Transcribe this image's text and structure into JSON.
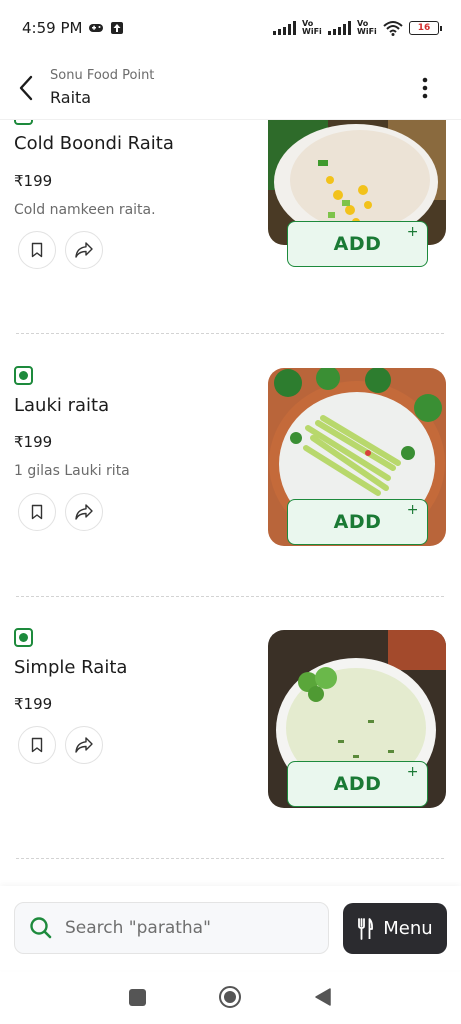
{
  "status": {
    "time": "4:59 PM",
    "vo_wifi_1": "Vo WiFi",
    "vo_wifi_2": "Vo WiFi",
    "battery": "16"
  },
  "header": {
    "restaurant": "Sonu Food Point",
    "category": "Raita"
  },
  "items": [
    {
      "name": "Cold Boondi Raita",
      "price": "₹199",
      "description": "Cold namkeen raita.",
      "add_label": "ADD",
      "add_plus": "+"
    },
    {
      "name": "Lauki raita",
      "price": "₹199",
      "description": "1 gilas Lauki rita",
      "add_label": "ADD",
      "add_plus": "+"
    },
    {
      "name": "Simple Raita",
      "price": "₹199",
      "description": "",
      "add_label": "ADD",
      "add_plus": "+"
    }
  ],
  "search": {
    "placeholder": "Search \"paratha\""
  },
  "menu_button": {
    "label": "Menu"
  },
  "colors": {
    "veg_green": "#1d8a3c",
    "add_bg": "#eaf7ee",
    "menu_bg": "#2b2b2f"
  }
}
